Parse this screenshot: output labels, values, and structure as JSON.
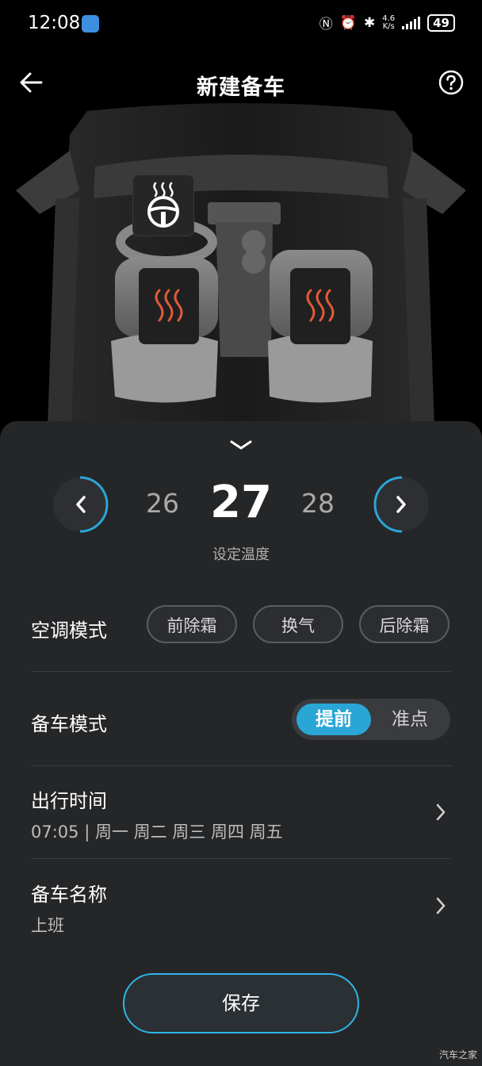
{
  "status_bar": {
    "time": "12:08",
    "net_speed_value": "4.6",
    "net_speed_unit": "K/s",
    "battery": "49",
    "icons": [
      "nfc-icon",
      "alarm-icon",
      "bluetooth-icon",
      "signal-icon",
      "battery-icon"
    ]
  },
  "header": {
    "title": "新建备车",
    "back_icon": "back-arrow-icon",
    "help_icon": "help-icon"
  },
  "car": {
    "steering_heat_icon": "steering-wheel-heat-icon",
    "left_seat_icon": "seat-heat-icon",
    "right_seat_icon": "seat-heat-icon"
  },
  "temperature": {
    "lower": "26",
    "current": "27",
    "higher": "28",
    "caption": "设定温度"
  },
  "ac_mode": {
    "label": "空调模式",
    "options": [
      "前除霜",
      "换气",
      "后除霜"
    ]
  },
  "prep_mode": {
    "label": "备车模式",
    "selected": "提前",
    "other": "准点",
    "accent": "#2aa6d6"
  },
  "departure": {
    "label": "出行时间",
    "value": "07:05 | 周一 周二 周三 周四 周五"
  },
  "prep_name": {
    "label": "备车名称",
    "value": "上班"
  },
  "save_label": "保存",
  "watermark": "汽车之家"
}
